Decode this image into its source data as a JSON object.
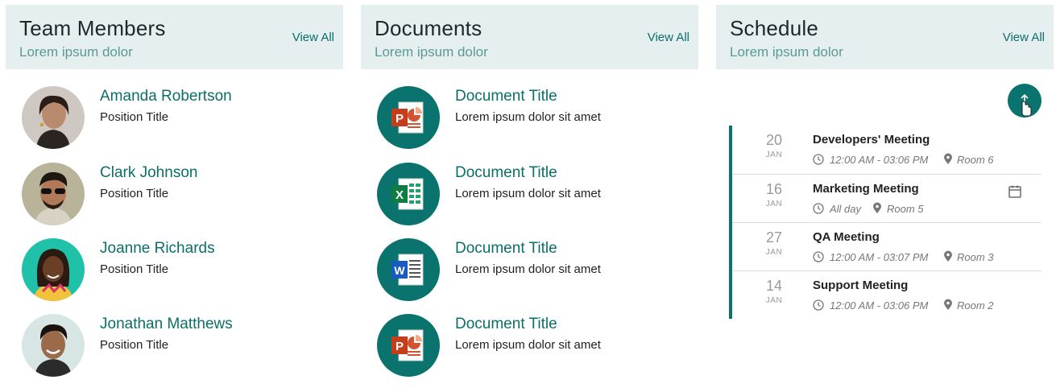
{
  "team": {
    "title": "Team Members",
    "subtitle": "Lorem ipsum dolor",
    "view_all": "View All",
    "members": [
      {
        "name": "Amanda Robertson",
        "position": "Position Title"
      },
      {
        "name": "Clark Johnson",
        "position": "Position Title"
      },
      {
        "name": "Joanne Richards",
        "position": "Position Title"
      },
      {
        "name": "Jonathan Matthews",
        "position": "Position Title"
      }
    ]
  },
  "documents": {
    "title": "Documents",
    "subtitle": "Lorem ipsum dolor",
    "view_all": "View All",
    "items": [
      {
        "title": "Document Title",
        "desc": "Lorem ipsum dolor sit amet",
        "icon": "powerpoint-icon"
      },
      {
        "title": "Document Title",
        "desc": "Lorem ipsum dolor sit amet",
        "icon": "excel-icon"
      },
      {
        "title": "Document Title",
        "desc": "Lorem ipsum dolor sit amet",
        "icon": "word-icon"
      },
      {
        "title": "Document Title",
        "desc": "Lorem ipsum dolor sit amet",
        "icon": "powerpoint-icon"
      }
    ]
  },
  "schedule": {
    "title": "Schedule",
    "subtitle": "Lorem ipsum dolor",
    "view_all": "View All",
    "events": [
      {
        "day": "20",
        "month": "JAN",
        "title": "Developers' Meeting",
        "time": "12:00 AM - 03:06 PM",
        "room": "Room 6"
      },
      {
        "day": "16",
        "month": "JAN",
        "title": "Marketing Meeting",
        "time": "All day",
        "room": "Room 5"
      },
      {
        "day": "27",
        "month": "JAN",
        "title": "QA Meeting",
        "time": "12:00 AM - 03:07 PM",
        "room": "Room 3"
      },
      {
        "day": "14",
        "month": "JAN",
        "title": "Support Meeting",
        "time": "12:00 AM - 03:06 PM",
        "room": "Room 2"
      }
    ]
  },
  "colors": {
    "accent": "#0b736d",
    "header_bg": "#e6efef",
    "subtitle": "#5a9a96"
  }
}
